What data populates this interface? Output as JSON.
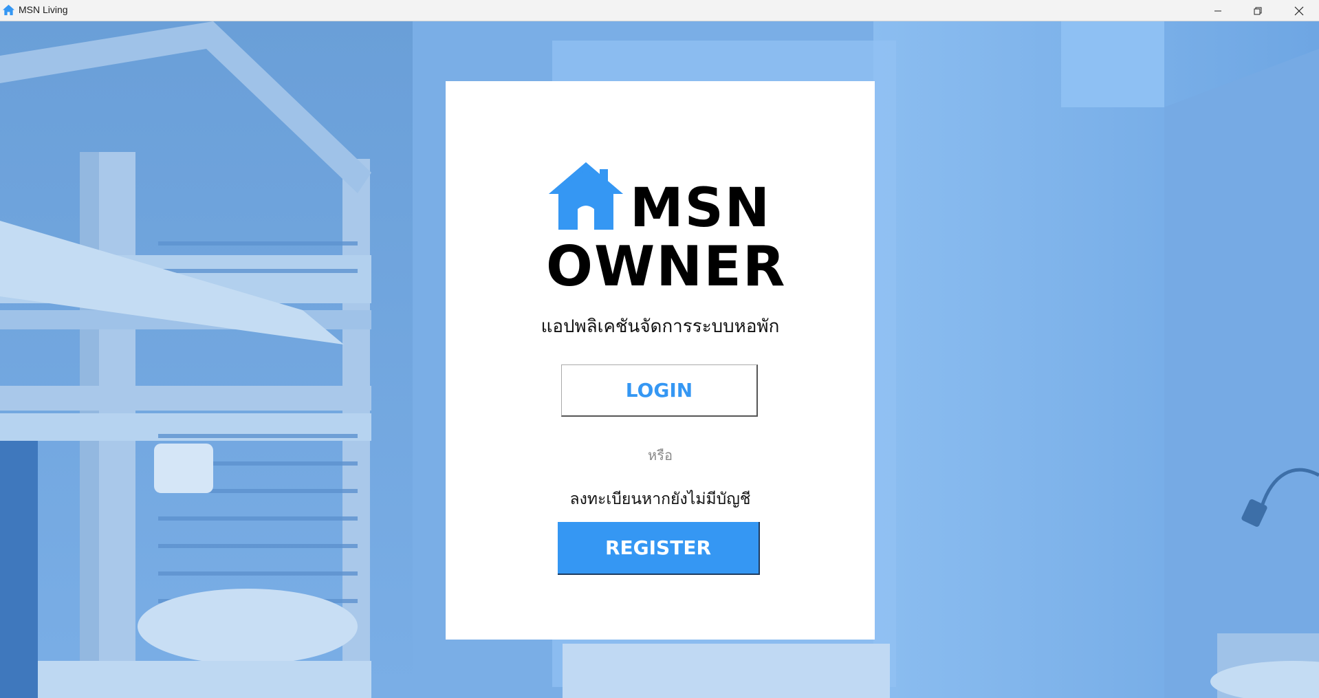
{
  "window": {
    "title": "MSN Living",
    "app_icon": "house-icon",
    "controls": [
      "minimize-icon",
      "restore-icon",
      "close-icon"
    ]
  },
  "logo": {
    "icon": "house-icon",
    "line1": "MSN",
    "line2": "OWNER",
    "color": "#3597f3"
  },
  "subtitle": "แอปพลิเคชันจัดการระบบหอพัก",
  "login_button": {
    "label": "LOGIN"
  },
  "divider_text": "หรือ",
  "register_hint": "ลงทะเบียนหากยังไม่มีบัญชี",
  "register_button": {
    "label": "REGISTER"
  },
  "colors": {
    "accent": "#3597f3",
    "background_tint": "#7aaee6"
  }
}
